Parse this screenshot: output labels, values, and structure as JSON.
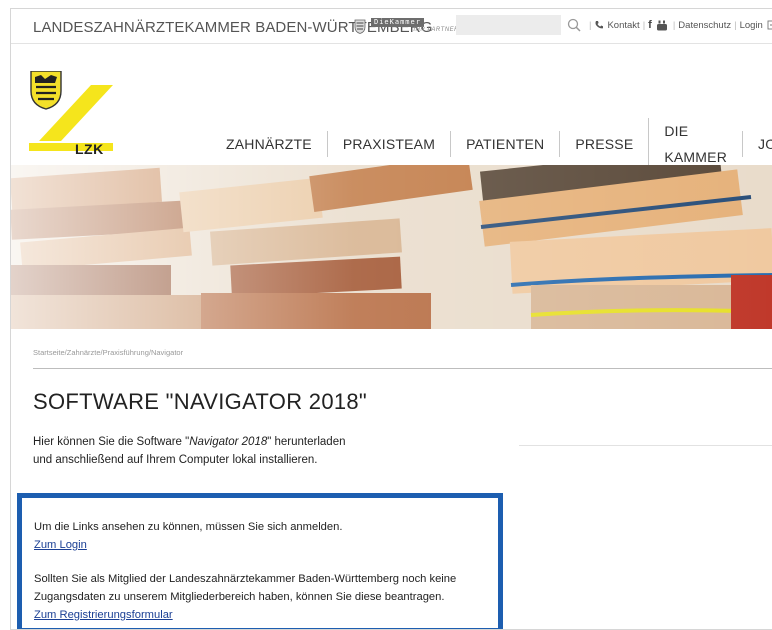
{
  "header": {
    "org_name": "LANDESZAHNÄRZTEKAMMER BADEN-WÜRTTEMBERG",
    "badge_title": "DieKammer",
    "badge_sub": "IHR PARTNER",
    "search_placeholder": "",
    "util": {
      "kontakt": "Kontakt",
      "datenschutz": "Datenschutz",
      "login": "Login"
    }
  },
  "logo_text": "LZK",
  "nav": [
    "ZAHNÄRZTE",
    "PRAXISTEAM",
    "PATIENTEN",
    "PRESSE",
    "DIE KAMMER",
    "JOBS"
  ],
  "breadcrumb": "Startseite/Zahnärzte/Praxisführung/Navigator",
  "page_title": "SOFTWARE \"NAVIGATOR 2018\"",
  "intro": {
    "part1": "Hier können Sie die Software \"",
    "italic": "Navigator 2018",
    "part2": "\" herunterladen",
    "line2": "und anschließend auf Ihrem Computer lokal installieren."
  },
  "notice": {
    "login_required": "Um die Links ansehen zu können, müssen Sie sich anmelden.",
    "login_link": "Zum Login",
    "member_line1": "Sollten Sie als Mitglied der Landeszahnärztekammer Baden-Württemberg noch keine",
    "member_line2": "Zugangsdaten zu unserem Mitgliederbereich haben, können Sie diese beantragen.",
    "register_link": "Zum Registrierungsformular"
  },
  "colors": {
    "accent_yellow": "#f5e51c",
    "notice_border": "#1d5eb0",
    "link": "#1a3f94"
  }
}
